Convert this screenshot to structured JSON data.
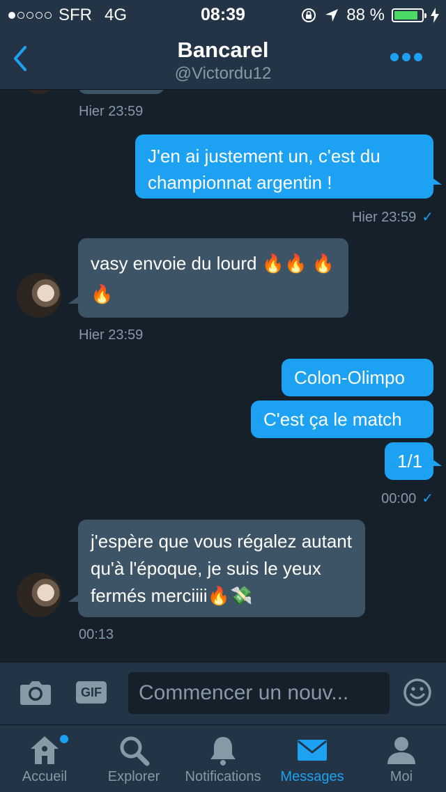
{
  "status": {
    "carrier": "SFR",
    "network": "4G",
    "time": "08:39",
    "battery": "88 %",
    "battery_level": 0.88
  },
  "header": {
    "title": "Bancarel",
    "handle": "@Victordu12"
  },
  "messages": [
    {
      "timestamp": "Hier 23:59"
    },
    {
      "text": "J'en ai justement un, c'est du championnat argentin !",
      "timestamp": "Hier 23:59"
    },
    {
      "text": "vasy envoie du lourd 🔥🔥 🔥🔥",
      "timestamp": "Hier 23:59"
    },
    {
      "texts": [
        "Colon-Olimpo",
        "C'est ça le match",
        "1/1"
      ],
      "timestamp": "00:00"
    },
    {
      "text": "j'espère que vous régalez autant qu'à l'époque, je suis le yeux fermés merciiii🔥💸",
      "timestamp": "00:13"
    }
  ],
  "composer": {
    "gif_label": "GIF",
    "placeholder": "Commencer un nouv..."
  },
  "tabs": [
    {
      "label": "Accueil",
      "icon": "home-icon"
    },
    {
      "label": "Explorer",
      "icon": "search-icon"
    },
    {
      "label": "Notifications",
      "icon": "bell-icon"
    },
    {
      "label": "Messages",
      "icon": "envelope-icon"
    },
    {
      "label": "Moi",
      "icon": "person-icon"
    }
  ],
  "colors": {
    "background": "#15202b",
    "bar": "#243447",
    "accent": "#1da1f2",
    "incoming_bubble": "#3d5466",
    "muted": "#8899a6"
  }
}
